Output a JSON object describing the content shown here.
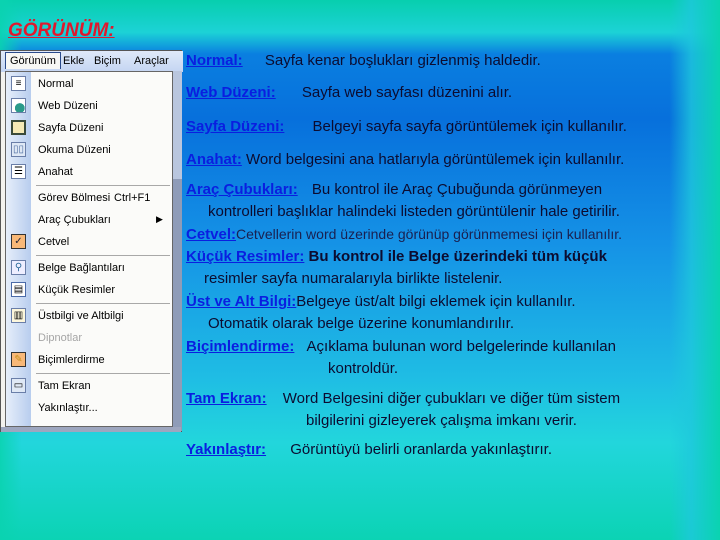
{
  "title": "GÖRÜNÜM:",
  "menubar": {
    "items": [
      "Görünüm",
      "Ekle",
      "Biçim",
      "Araçlar"
    ]
  },
  "menu": {
    "items": [
      {
        "label": "Normal",
        "icon": "normal-view-icon"
      },
      {
        "label": "Web Düzeni",
        "icon": "web-layout-icon"
      },
      {
        "label": "Sayfa Düzeni",
        "icon": "page-layout-icon"
      },
      {
        "label": "Okuma Düzeni",
        "icon": "reading-layout-icon"
      },
      {
        "label": "Anahat",
        "icon": "outline-icon"
      },
      {
        "label": "Görev Bölmesi",
        "shortcut": "Ctrl+F1"
      },
      {
        "label": "Araç Çubukları",
        "submenu": "▶"
      },
      {
        "label": "Cetvel",
        "icon": "check-icon",
        "checked": true
      },
      {
        "label": "Belge Bağlantıları",
        "icon": "document-map-icon"
      },
      {
        "label": "Küçük Resimler",
        "icon": "thumbnails-icon"
      },
      {
        "label": "Üstbilgi ve Altbilgi",
        "icon": "header-footer-icon"
      },
      {
        "label": "Dipnotlar",
        "disabled": true
      },
      {
        "label": "Biçimlerdirme",
        "icon": "markup-icon"
      },
      {
        "label": "Tam Ekran",
        "icon": "full-screen-icon"
      },
      {
        "label": "Yakınlaştır..."
      }
    ]
  },
  "definitions": [
    {
      "term": "Normal:",
      "desc": "Sayfa kenar boşlukları gizlenmiş haldedir."
    },
    {
      "term": "Web Düzeni:",
      "desc": "Sayfa web sayfası düzenini alır."
    },
    {
      "term": "Sayfa Düzeni:",
      "desc": "Belgeyi sayfa sayfa görüntülemek için kullanılır."
    },
    {
      "term": "Anahat:",
      "desc": "Word belgesini ana hatlarıyla görüntülemek için kullanılır."
    },
    {
      "term": "Araç Çubukları:",
      "desc": "Bu kontrol ile Araç Çubuğunda görünmeyen",
      "cont": "kontrolleri başlıklar halindeki listeden görüntülenir hale getirilir."
    },
    {
      "term": "Cetvel:",
      "desc": "Cetvellerin word üzerinde görünüp görünmemesi için kullanılır."
    },
    {
      "term": "Küçük Resimler:",
      "desc": "Bu kontrol ile Belge üzerindeki tüm küçük",
      "cont": "resimler sayfa numaralarıyla birlikte listelenir."
    },
    {
      "term": "Üst ve Alt Bilgi:",
      "desc": "Belgeye üst/alt bilgi eklemek için kullanılır.",
      "cont": "Otomatik olarak belge üzerine konumlandırılır."
    },
    {
      "term": "Biçimlendirme:",
      "desc": "Açıklama bulunan word belgelerinde kullanılan",
      "cont": "kontroldür."
    },
    {
      "term": "Tam Ekran:",
      "desc": "Word Belgesini diğer çubukları ve diğer tüm sistem",
      "cont": "bilgilerini gizleyerek çalışma imkanı verir."
    },
    {
      "term": "Yakınlaştır:",
      "desc": "Görüntüyü belirli oranlarda yakınlaştırır."
    }
  ],
  "colors": {
    "title": "#e0182d",
    "term": "#0a1ee0",
    "text": "#0c0c30"
  }
}
